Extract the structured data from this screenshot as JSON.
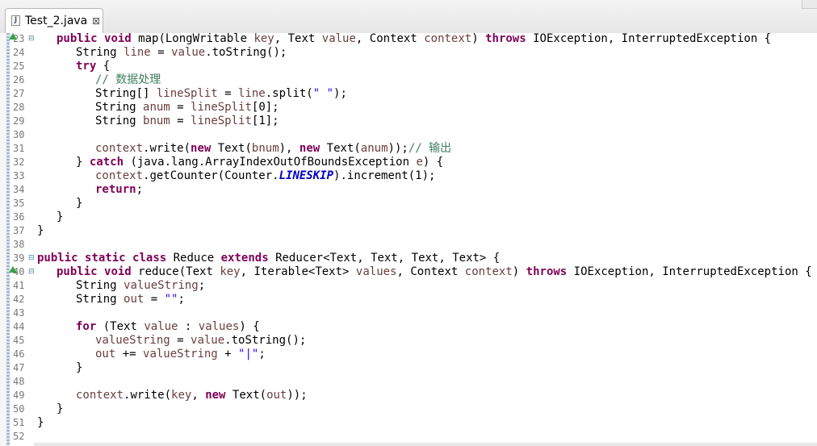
{
  "tab": {
    "title": "Test_2.java",
    "close_glyph": "⊠",
    "file_icon_letter": "J"
  },
  "editor": {
    "lines": [
      {
        "n": "23",
        "fold": "⊟",
        "marker": "override",
        "indent": 1,
        "tokens": [
          [
            "kw",
            "public"
          ],
          [
            "p",
            " "
          ],
          [
            "kw",
            "void"
          ],
          [
            "p",
            " map(LongWritable "
          ],
          [
            "f",
            "key"
          ],
          [
            "p",
            ", Text "
          ],
          [
            "f",
            "value"
          ],
          [
            "p",
            ", Context "
          ],
          [
            "f",
            "context"
          ],
          [
            "p",
            ") "
          ],
          [
            "kw",
            "throws"
          ],
          [
            "p",
            " IOException, InterruptedException {"
          ]
        ]
      },
      {
        "n": "24",
        "indent": 2,
        "tokens": [
          [
            "p",
            "String "
          ],
          [
            "f",
            "line"
          ],
          [
            "p",
            " = "
          ],
          [
            "f",
            "value"
          ],
          [
            "p",
            ".toString();"
          ]
        ]
      },
      {
        "n": "25",
        "indent": 2,
        "tokens": [
          [
            "kw",
            "try"
          ],
          [
            "p",
            " {"
          ]
        ]
      },
      {
        "n": "26",
        "indent": 3,
        "tokens": [
          [
            "c",
            "// 数据处理"
          ]
        ]
      },
      {
        "n": "27",
        "indent": 3,
        "tokens": [
          [
            "p",
            "String[] "
          ],
          [
            "f",
            "lineSplit"
          ],
          [
            "p",
            " = "
          ],
          [
            "f",
            "line"
          ],
          [
            "p",
            ".split("
          ],
          [
            "s",
            "\" \""
          ],
          [
            "p",
            ");"
          ]
        ]
      },
      {
        "n": "28",
        "indent": 3,
        "tokens": [
          [
            "p",
            "String "
          ],
          [
            "f",
            "anum"
          ],
          [
            "p",
            " = "
          ],
          [
            "f",
            "lineSplit"
          ],
          [
            "p",
            "[0];"
          ]
        ]
      },
      {
        "n": "29",
        "indent": 3,
        "tokens": [
          [
            "p",
            "String "
          ],
          [
            "f",
            "bnum"
          ],
          [
            "p",
            " = "
          ],
          [
            "f",
            "lineSplit"
          ],
          [
            "p",
            "[1];"
          ]
        ]
      },
      {
        "n": "30",
        "indent": 0,
        "tokens": []
      },
      {
        "n": "31",
        "indent": 3,
        "tokens": [
          [
            "f",
            "context"
          ],
          [
            "p",
            ".write("
          ],
          [
            "kw",
            "new"
          ],
          [
            "p",
            " Text("
          ],
          [
            "f",
            "bnum"
          ],
          [
            "p",
            "), "
          ],
          [
            "kw",
            "new"
          ],
          [
            "p",
            " Text("
          ],
          [
            "f",
            "anum"
          ],
          [
            "p",
            "));"
          ],
          [
            "c",
            "// 输出"
          ]
        ]
      },
      {
        "n": "32",
        "indent": 2,
        "tokens": [
          [
            "p",
            "} "
          ],
          [
            "kw",
            "catch"
          ],
          [
            "p",
            " (java.lang.ArrayIndexOutOfBoundsException "
          ],
          [
            "f",
            "e"
          ],
          [
            "p",
            ") {"
          ]
        ]
      },
      {
        "n": "33",
        "indent": 3,
        "tokens": [
          [
            "f",
            "context"
          ],
          [
            "p",
            ".getCounter(Counter."
          ],
          [
            "k",
            "LINESKIP"
          ],
          [
            "p",
            ").increment(1);"
          ]
        ]
      },
      {
        "n": "34",
        "indent": 3,
        "tokens": [
          [
            "kw",
            "return"
          ],
          [
            "p",
            ";"
          ]
        ]
      },
      {
        "n": "35",
        "indent": 2,
        "tokens": [
          [
            "p",
            "}"
          ]
        ]
      },
      {
        "n": "36",
        "indent": 1,
        "tokens": [
          [
            "p",
            "}"
          ]
        ]
      },
      {
        "n": "37",
        "indent": 0,
        "tokens": [
          [
            "p",
            "}"
          ]
        ]
      },
      {
        "n": "38",
        "indent": 0,
        "tokens": []
      },
      {
        "n": "39",
        "fold": "⊟",
        "indent": 0,
        "tokens": [
          [
            "kw",
            "public"
          ],
          [
            "p",
            " "
          ],
          [
            "kw",
            "static"
          ],
          [
            "p",
            " "
          ],
          [
            "kw",
            "class"
          ],
          [
            "p",
            " Reduce "
          ],
          [
            "kw",
            "extends"
          ],
          [
            "p",
            " Reducer<Text, Text, Text, Text> {"
          ]
        ]
      },
      {
        "n": "40",
        "fold": "⊟",
        "marker": "override",
        "indent": 1,
        "tokens": [
          [
            "kw",
            "public"
          ],
          [
            "p",
            " "
          ],
          [
            "kw",
            "void"
          ],
          [
            "p",
            " reduce(Text "
          ],
          [
            "f",
            "key"
          ],
          [
            "p",
            ", Iterable<Text> "
          ],
          [
            "f",
            "values"
          ],
          [
            "p",
            ", Context "
          ],
          [
            "f",
            "context"
          ],
          [
            "p",
            ") "
          ],
          [
            "kw",
            "throws"
          ],
          [
            "p",
            " IOException, InterruptedException {"
          ]
        ]
      },
      {
        "n": "41",
        "indent": 2,
        "tokens": [
          [
            "p",
            "String "
          ],
          [
            "f",
            "valueString"
          ],
          [
            "p",
            ";"
          ]
        ]
      },
      {
        "n": "42",
        "indent": 2,
        "tokens": [
          [
            "p",
            "String "
          ],
          [
            "f",
            "out"
          ],
          [
            "p",
            " = "
          ],
          [
            "s",
            "\"\""
          ],
          [
            "p",
            ";"
          ]
        ]
      },
      {
        "n": "43",
        "indent": 0,
        "tokens": []
      },
      {
        "n": "44",
        "indent": 2,
        "tokens": [
          [
            "kw",
            "for"
          ],
          [
            "p",
            " (Text "
          ],
          [
            "f",
            "value"
          ],
          [
            "p",
            " : "
          ],
          [
            "f",
            "values"
          ],
          [
            "p",
            ") {"
          ]
        ]
      },
      {
        "n": "45",
        "indent": 3,
        "tokens": [
          [
            "f",
            "valueString"
          ],
          [
            "p",
            " = "
          ],
          [
            "f",
            "value"
          ],
          [
            "p",
            ".toString();"
          ]
        ]
      },
      {
        "n": "46",
        "indent": 3,
        "tokens": [
          [
            "f",
            "out"
          ],
          [
            "p",
            " += "
          ],
          [
            "f",
            "valueString"
          ],
          [
            "p",
            " + "
          ],
          [
            "s",
            "\"|\""
          ],
          [
            "p",
            ";"
          ]
        ]
      },
      {
        "n": "47",
        "indent": 2,
        "tokens": [
          [
            "p",
            "}"
          ]
        ]
      },
      {
        "n": "48",
        "indent": 0,
        "tokens": []
      },
      {
        "n": "49",
        "indent": 2,
        "tokens": [
          [
            "f",
            "context"
          ],
          [
            "p",
            ".write("
          ],
          [
            "f",
            "key"
          ],
          [
            "p",
            ", "
          ],
          [
            "kw",
            "new"
          ],
          [
            "p",
            " Text("
          ],
          [
            "f",
            "out"
          ],
          [
            "p",
            "));"
          ]
        ]
      },
      {
        "n": "50",
        "indent": 1,
        "tokens": [
          [
            "p",
            "}"
          ]
        ]
      },
      {
        "n": "51",
        "indent": 0,
        "tokens": [
          [
            "p",
            "}"
          ]
        ]
      },
      {
        "n": "52",
        "indent": 0,
        "tokens": []
      }
    ]
  }
}
